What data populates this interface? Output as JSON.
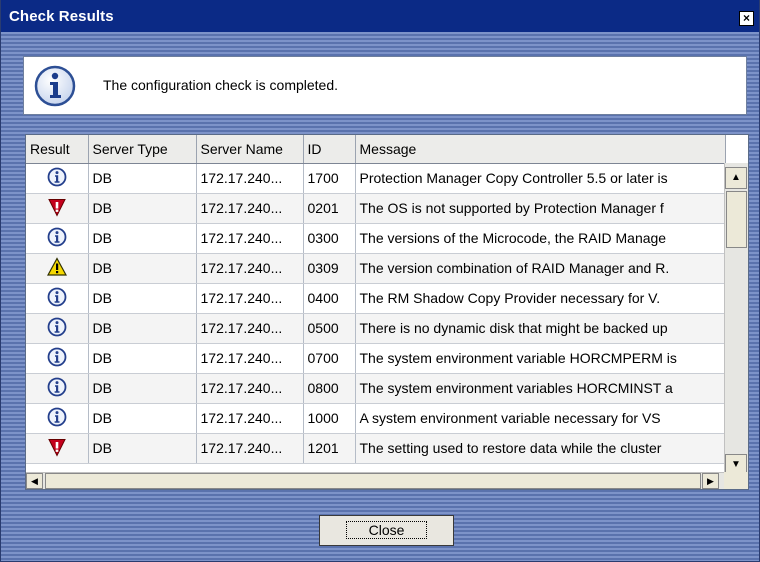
{
  "window": {
    "title": "Check Results",
    "close_glyph": "×"
  },
  "info": {
    "message": "The configuration check is completed.",
    "icon": "info-icon"
  },
  "table": {
    "columns": [
      "Result",
      "Server Type",
      "Server Name",
      "ID",
      "Message"
    ],
    "rows": [
      {
        "result": "info",
        "server_type": "DB",
        "server_name": "172.17.240...",
        "id": "1700",
        "message": "Protection Manager Copy Controller 5.5 or later is"
      },
      {
        "result": "error",
        "server_type": "DB",
        "server_name": "172.17.240...",
        "id": "0201",
        "message": "The OS is not supported by Protection Manager f"
      },
      {
        "result": "info",
        "server_type": "DB",
        "server_name": "172.17.240...",
        "id": "0300",
        "message": "The versions of the Microcode, the RAID Manage"
      },
      {
        "result": "warning",
        "server_type": "DB",
        "server_name": "172.17.240...",
        "id": "0309",
        "message": "The version combination of RAID Manager and R."
      },
      {
        "result": "info",
        "server_type": "DB",
        "server_name": "172.17.240...",
        "id": "0400",
        "message": "The RM Shadow Copy Provider necessary for V."
      },
      {
        "result": "info",
        "server_type": "DB",
        "server_name": "172.17.240...",
        "id": "0500",
        "message": "There is no dynamic disk that might be backed up"
      },
      {
        "result": "info",
        "server_type": "DB",
        "server_name": "172.17.240...",
        "id": "0700",
        "message": "The system environment variable HORCMPERM is"
      },
      {
        "result": "info",
        "server_type": "DB",
        "server_name": "172.17.240...",
        "id": "0800",
        "message": "The system environment variables HORCMINST a"
      },
      {
        "result": "info",
        "server_type": "DB",
        "server_name": "172.17.240...",
        "id": "1000",
        "message": "A system environment variable necessary for VS"
      },
      {
        "result": "error",
        "server_type": "DB",
        "server_name": "172.17.240...",
        "id": "1201",
        "message": "The setting used to restore data while the cluster"
      }
    ]
  },
  "buttons": {
    "close_label": "Close"
  },
  "colors": {
    "titlebar": "#0b2a86",
    "frame": "#5c74ad",
    "error": "#c4001c",
    "warning": "#f5d800",
    "info": "#2450b8"
  }
}
